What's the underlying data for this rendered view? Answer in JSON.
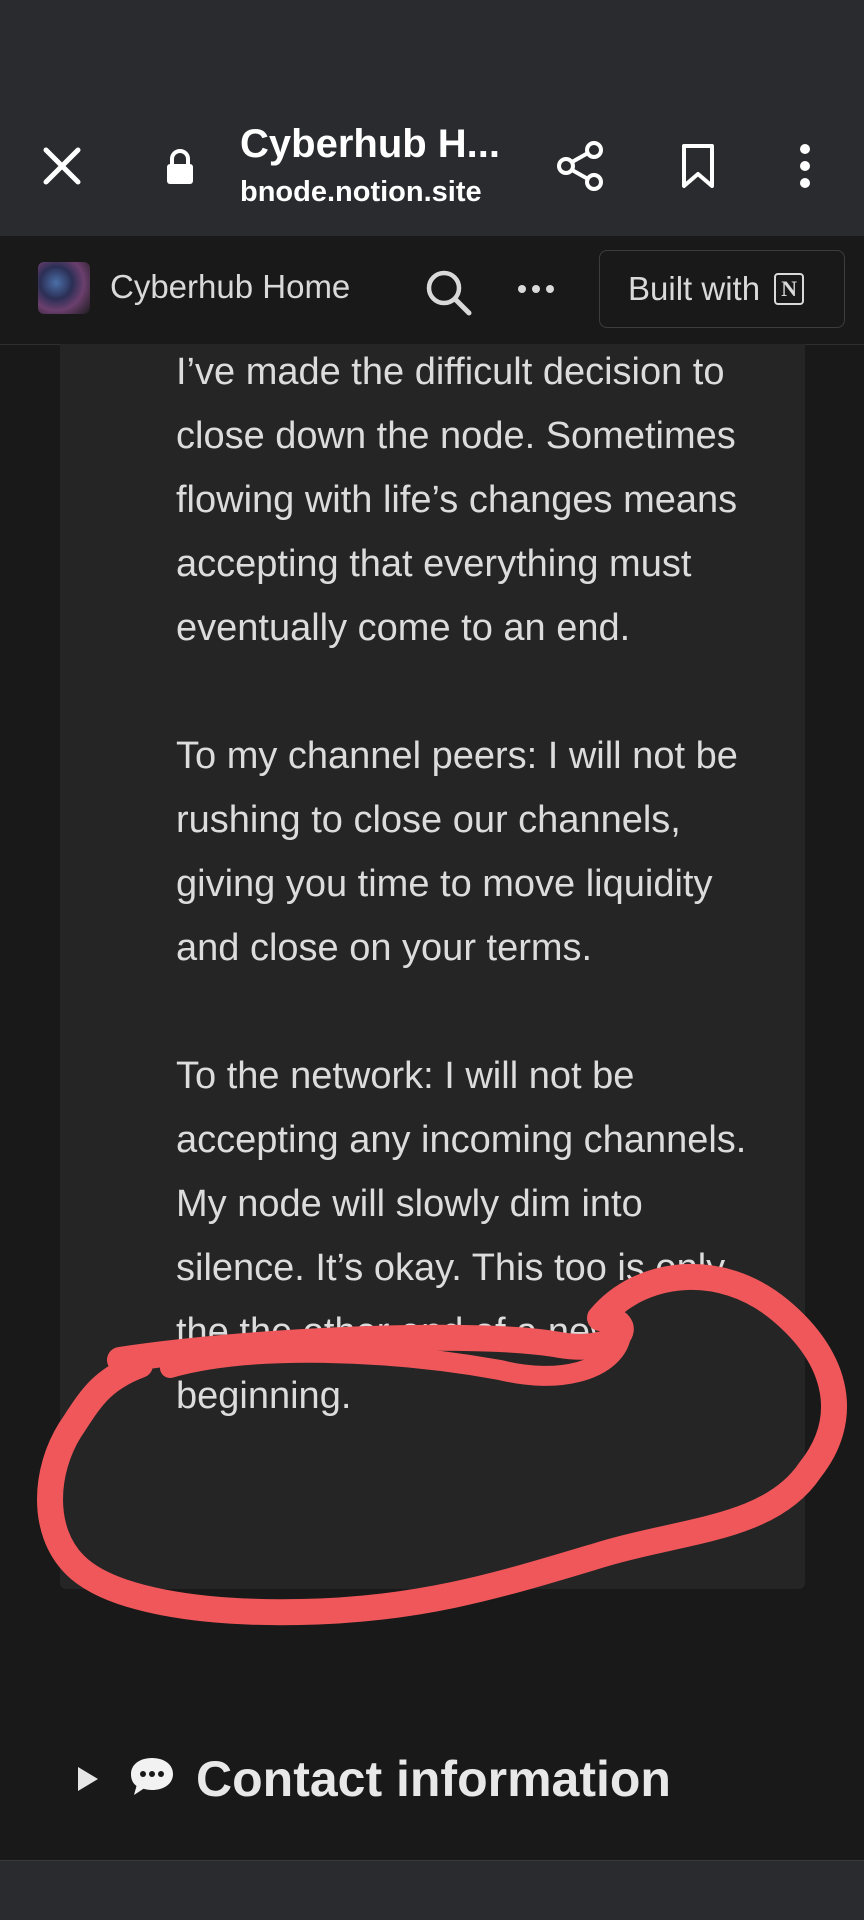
{
  "browser": {
    "title": "Cyberhub H...",
    "domain": "bnode.notion.site"
  },
  "notion_header": {
    "site_title": "Cyberhub Home",
    "built_with_label": "Built with",
    "notion_logo_letter": "N"
  },
  "callout": {
    "paragraphs": [
      "I’ve made the difficult decision to close down the node. Sometimes flowing with life’s changes means accepting that everything must eventually come to an end.",
      "To my channel peers: I will not be rushing to close our channels, giving you time to move liquidity and close on your terms.",
      "To the network: I will not be accepting any incoming channels. My node will slowly dim into silence. It’s okay. This too is only the the other end of a new beginning."
    ]
  },
  "toggle": {
    "title": "Contact information"
  },
  "colors": {
    "annotation_red": "#f0575a",
    "background": "#191919",
    "callout_bg": "#252525"
  }
}
